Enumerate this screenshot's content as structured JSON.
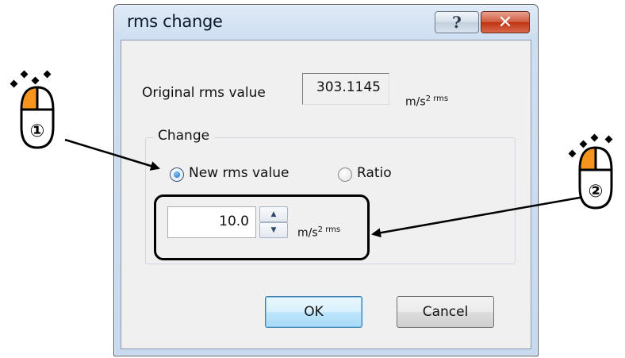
{
  "dialog": {
    "title": "rms change",
    "help_glyph": "?",
    "close_glyph": "✕"
  },
  "original": {
    "label": "Original rms value",
    "value": "303.1145",
    "unit_main": "m/s",
    "unit_sup": "2 rms"
  },
  "change_group": {
    "title": "Change",
    "option_new": "New rms value",
    "option_ratio": "Ratio",
    "selected": "New rms value",
    "input_value": "10.0",
    "unit_main": "m/s",
    "unit_sup": "2 rms"
  },
  "buttons": {
    "ok": "OK",
    "cancel": "Cancel"
  },
  "annotations": {
    "step1": "①",
    "step2": "②",
    "mouse_highlight_color": "#f7941d"
  },
  "colors": {
    "title_bar": "#cfdff2",
    "close_button": "#c8452a",
    "ok_button": "#bee6fd"
  }
}
